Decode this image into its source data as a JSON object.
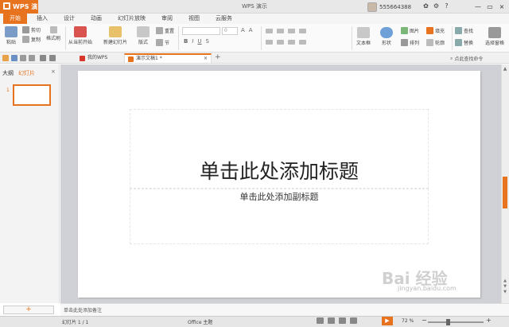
{
  "app": {
    "name": "WPS 演示",
    "window_title": "WPS 演示",
    "user": "555664388"
  },
  "window": {
    "minimize": "—",
    "restore": "▭",
    "close": "×"
  },
  "title_icons": {
    "skin": "✿",
    "help": "?",
    "settings": "⚙"
  },
  "tabs": [
    {
      "label": "开始",
      "active": true
    },
    {
      "label": "插入"
    },
    {
      "label": "设计"
    },
    {
      "label": "动画"
    },
    {
      "label": "幻灯片放映"
    },
    {
      "label": "审阅"
    },
    {
      "label": "视图"
    },
    {
      "label": "云服务"
    }
  ],
  "ribbon": {
    "paste": "粘贴",
    "cut": "剪切",
    "copy": "复制",
    "format_painter": "格式刷",
    "from_current": "从当前开始",
    "new_slide": "新建幻灯片",
    "layout": "版式",
    "reset": "重置",
    "section": "节",
    "font_size": "0",
    "bold": "B",
    "italic": "I",
    "underline": "U",
    "strike": "S",
    "textbox": "文本框",
    "shape": "形状",
    "picture": "图片",
    "fill": "填充",
    "arrange": "排列",
    "outline": "轮廓",
    "find": "查找",
    "replace": "替换",
    "select_pane": "选择窗格"
  },
  "doc_tabs": {
    "my_wps": "我的WPS",
    "current_doc": "演示文稿1 *"
  },
  "search_help": "点此查找命令",
  "panel": {
    "outline_tab": "大纲",
    "slides_tab": "幻灯片",
    "close": "×",
    "thumb_number": "1",
    "add_slide": "+"
  },
  "slide": {
    "title": "单击此处添加标题",
    "subtitle": "单击此处添加副标题"
  },
  "notes_placeholder": "单击此处添加备注",
  "status": {
    "slide_info": "幻灯片 1 / 1",
    "theme": "Office 主题",
    "zoom": "72 %",
    "zoom_level": 0.35
  },
  "watermark": {
    "brand": "Bai 经验",
    "url": "jingyan.baidu.com"
  },
  "colors": {
    "accent": "#e8731f"
  }
}
